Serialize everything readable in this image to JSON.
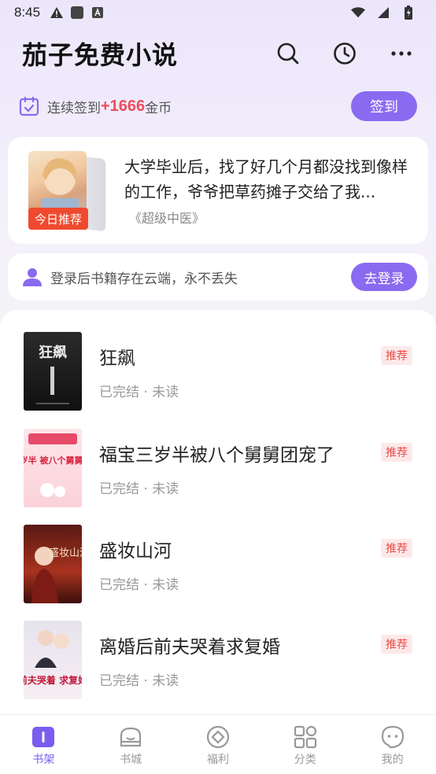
{
  "status_bar": {
    "time": "8:45"
  },
  "header": {
    "title": "茄子免费小说"
  },
  "checkin": {
    "prefix": "连续签到",
    "amount": "+1666",
    "suffix": "金币",
    "button": "签到"
  },
  "recommend": {
    "badge": "今日推荐",
    "description": "大学毕业后，找了好几个月都没找到像样的工作，爷爷把草药摊子交给了我...",
    "book": "《超级中医》"
  },
  "login": {
    "text": "登录后书籍存在云端，永不丢失",
    "button": "去登录"
  },
  "books": [
    {
      "title": "狂飙",
      "status": "已完结 · 未读",
      "tag": "推荐",
      "cover_text": "狂飙"
    },
    {
      "title": "福宝三岁半被八个舅舅团宠了",
      "status": "已完结 · 未读",
      "tag": "推荐",
      "cover_text": "福宝三岁半 被八个舅舅 团宠了"
    },
    {
      "title": "盛妆山河",
      "status": "已完结 · 未读",
      "tag": "推荐",
      "cover_text": "盛妆山河"
    },
    {
      "title": "离婚后前夫哭着求复婚",
      "status": "已完结 · 未读",
      "tag": "推荐",
      "cover_text": "前夫哭着 求复婚"
    }
  ],
  "tabs": [
    {
      "label": "书架",
      "icon": "bookshelf-icon",
      "active": true
    },
    {
      "label": "书城",
      "icon": "bookstore-icon",
      "active": false
    },
    {
      "label": "福利",
      "icon": "welfare-icon",
      "active": false
    },
    {
      "label": "分类",
      "icon": "category-icon",
      "active": false
    },
    {
      "label": "我的",
      "icon": "profile-icon",
      "active": false
    }
  ],
  "colors": {
    "accent": "#8a6af0",
    "coin": "#ee4d5f",
    "badge": "#ef4a2f"
  }
}
